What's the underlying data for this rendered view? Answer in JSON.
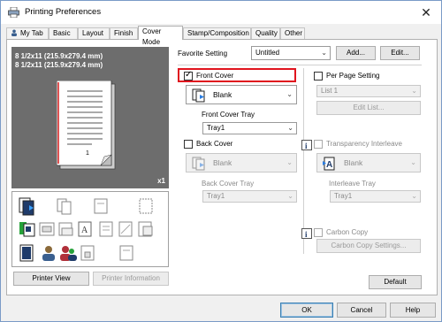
{
  "window": {
    "title": "Printing Preferences",
    "close_glyph": "✕"
  },
  "tabs": [
    {
      "label": "My Tab"
    },
    {
      "label": "Basic"
    },
    {
      "label": "Layout"
    },
    {
      "label": "Finish"
    },
    {
      "label": "Cover Mode"
    },
    {
      "label": "Stamp/Composition"
    },
    {
      "label": "Quality"
    },
    {
      "label": "Other"
    }
  ],
  "favorite": {
    "label": "Favorite Setting",
    "value": "Untitled",
    "add_label": "Add...",
    "edit_label": "Edit..."
  },
  "preview": {
    "size_line1": "8 1/2x11 (215.9x279.4 mm)",
    "size_line2": "8 1/2x11 (215.9x279.4 mm)",
    "copies": "x1",
    "page_number": "1"
  },
  "left_buttons": {
    "printer_view": "Printer View",
    "printer_information": "Printer Information"
  },
  "front_cover": {
    "label": "Front Cover",
    "checked": true,
    "type_value": "Blank",
    "tray_label": "Front Cover Tray",
    "tray_value": "Tray1"
  },
  "back_cover": {
    "label": "Back Cover",
    "checked": false,
    "type_value": "Blank",
    "tray_label": "Back Cover Tray",
    "tray_value": "Tray1"
  },
  "per_page": {
    "label": "Per Page Setting",
    "list_value": "List 1",
    "edit_list_label": "Edit List..."
  },
  "transparency": {
    "label": "Transparency Interleave",
    "type_value": "Blank",
    "tray_label": "Interleave Tray",
    "tray_value": "Tray1"
  },
  "carbon": {
    "label": "Carbon Copy",
    "settings_label": "Carbon Copy Settings..."
  },
  "buttons": {
    "default": "Default",
    "ok": "OK",
    "cancel": "Cancel",
    "help": "Help"
  },
  "colors": {
    "highlight": "#e0141e",
    "preview_bg": "#6d6d6d",
    "accent": "#3c7fb1"
  }
}
